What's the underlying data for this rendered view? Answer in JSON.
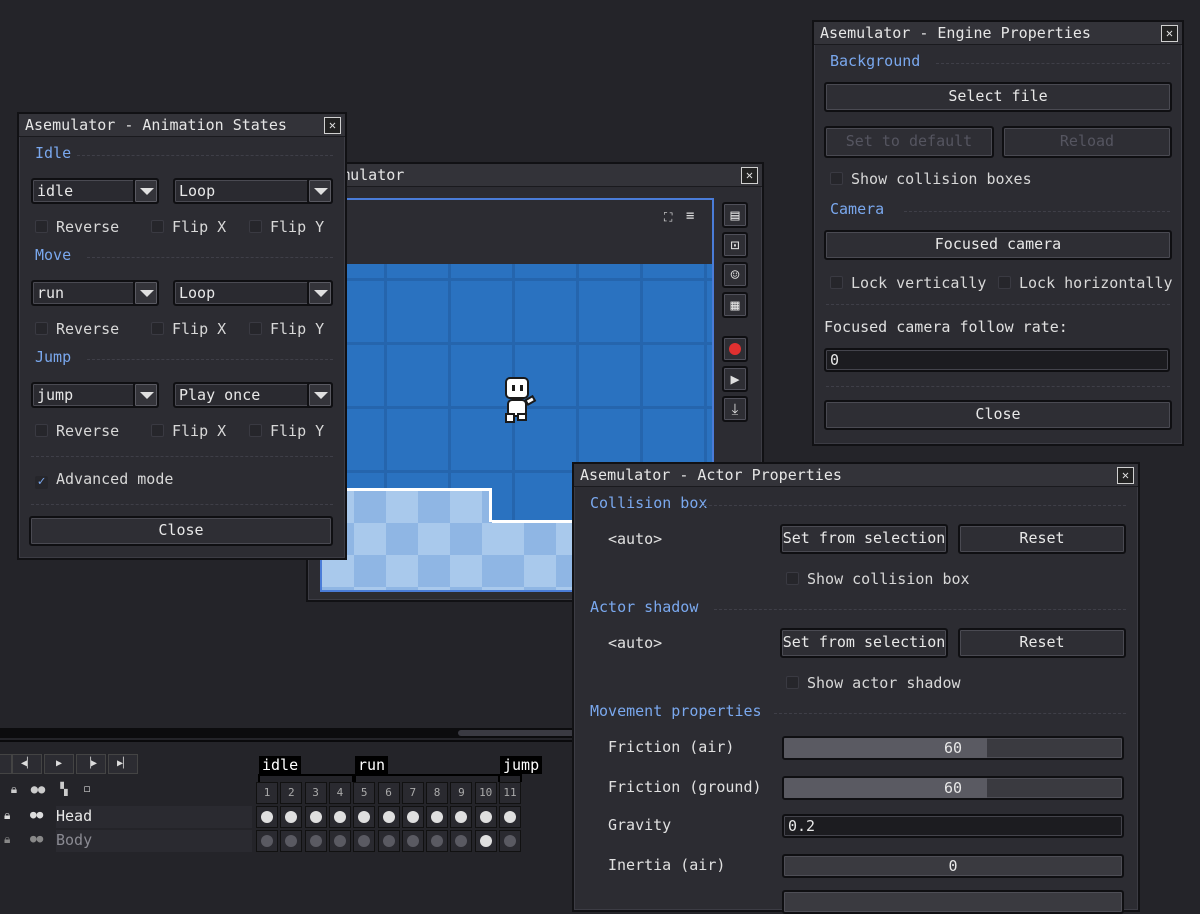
{
  "colors": {
    "accent": "#7aa8ee",
    "record": "#e03030",
    "canvas_blue": "#2a72c0"
  },
  "anim_win": {
    "title": "Asemulator - Animation States",
    "sections": [
      {
        "name": "Idle",
        "anim": "idle",
        "mode": "Loop"
      },
      {
        "name": "Move",
        "anim": "run",
        "mode": "Loop"
      },
      {
        "name": "Jump",
        "anim": "jump",
        "mode": "Play once"
      }
    ],
    "reverse": "Reverse",
    "flipx": "Flip X",
    "flipy": "Flip Y",
    "advanced": "Advanced mode",
    "close": "Close"
  },
  "preview_win": {
    "title": "Asemulator"
  },
  "engine_win": {
    "title": "Asemulator - Engine Properties",
    "background": "Background",
    "select_file": "Select file",
    "set_default": "Set to default",
    "reload": "Reload",
    "show_collision": "Show collision boxes",
    "camera": "Camera",
    "focused_camera": "Focused camera",
    "lock_v": "Lock vertically",
    "lock_h": "Lock horizontally",
    "follow_label": "Focused camera follow rate:",
    "follow_value": "0",
    "close": "Close"
  },
  "actor_win": {
    "title": "Asemulator - Actor Properties",
    "collision_box": "Collision box",
    "auto": "<auto>",
    "set_from_selection": "Set from selection",
    "reset": "Reset",
    "show_collision_box": "Show collision box",
    "actor_shadow": "Actor shadow",
    "show_actor_shadow": "Show actor shadow",
    "movement": "Movement properties",
    "props": [
      {
        "label": "Friction (air)",
        "value": "60",
        "type": "slider",
        "level": 0.6
      },
      {
        "label": "Friction (ground)",
        "value": "60",
        "type": "slider",
        "level": 0.6
      },
      {
        "label": "Gravity",
        "value": "0.2",
        "type": "field"
      },
      {
        "label": "Inertia (air)",
        "value": "0",
        "type": "slider",
        "level": 0
      }
    ]
  },
  "timeline": {
    "tags": [
      "idle",
      "run",
      "jump"
    ],
    "frames": [
      "1",
      "2",
      "3",
      "4",
      "5",
      "6",
      "7",
      "8",
      "9",
      "10",
      "11"
    ],
    "layers": [
      "Head",
      "Body"
    ]
  }
}
